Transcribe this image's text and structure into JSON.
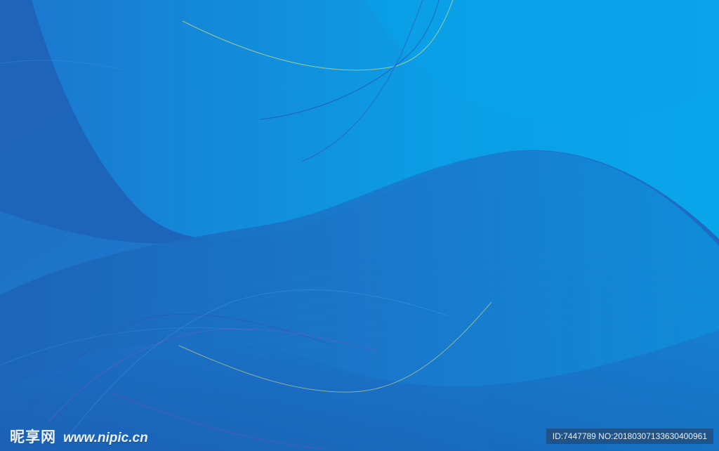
{
  "watermark": {
    "site_name_cn": "昵享网",
    "site_url": "www.nipic.cn"
  },
  "image_info": {
    "id_label": "ID:7447789 NO:20180307133630400961"
  },
  "colors": {
    "base_dark": "#1a5fb4",
    "base_mid": "#1e7ad0",
    "base_light": "#0aa0e8",
    "accent_line_yellow": "#d8e07a",
    "accent_line_purple": "#6a5bc4"
  }
}
